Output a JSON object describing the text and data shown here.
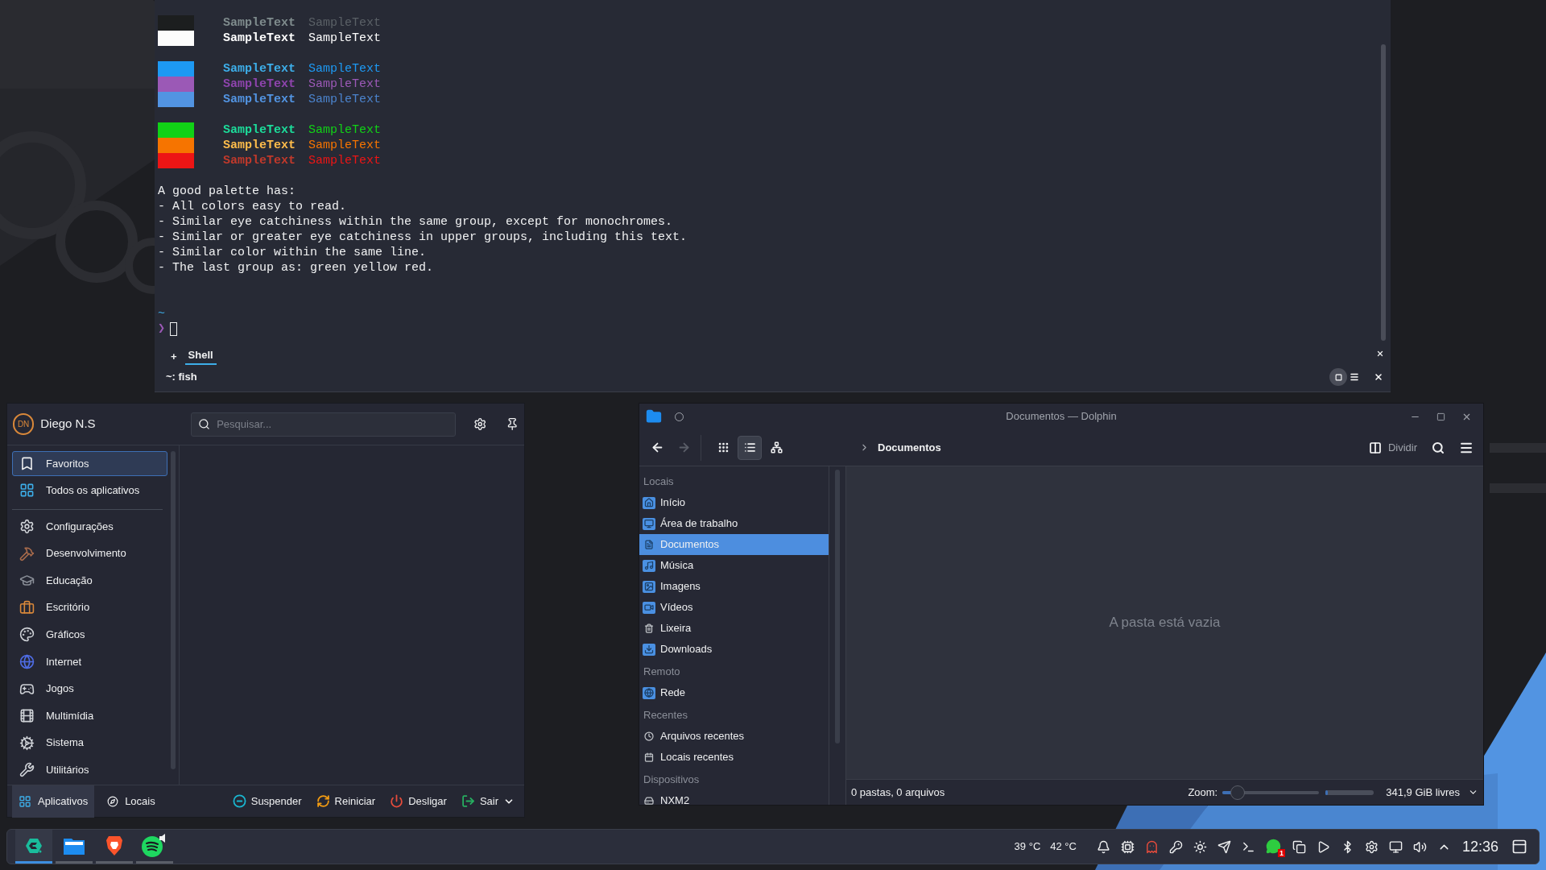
{
  "terminal": {
    "palette_groups": [
      {
        "rows": [
          {
            "color": "#1c1e1f",
            "bold": {
              "text": "SampleText",
              "color": "#7f8c8d"
            },
            "regular": {
              "text": "SampleText",
              "color": "#5a6066"
            }
          },
          {
            "color": "#fcfcfc",
            "bold": {
              "text": "SampleText",
              "color": "#ffffff"
            },
            "regular": {
              "text": "SampleText",
              "color": "#fcfcfc"
            }
          }
        ]
      },
      {
        "rows": [
          {
            "color": "#1d99f3",
            "bold": {
              "text": "SampleText",
              "color": "#3daee9"
            },
            "regular": {
              "text": "SampleText",
              "color": "#1d99f3"
            }
          },
          {
            "color": "#9b59b6",
            "bold": {
              "text": "SampleText",
              "color": "#8e44ad"
            },
            "regular": {
              "text": "SampleText",
              "color": "#9b59b6"
            }
          },
          {
            "color": "#5294e2",
            "bold": {
              "text": "SampleText",
              "color": "#5294e2"
            },
            "regular": {
              "text": "SampleText",
              "color": "#4b83cc"
            }
          }
        ]
      },
      {
        "rows": [
          {
            "color": "#11d116",
            "bold": {
              "text": "SampleText",
              "color": "#1cdc9a"
            },
            "regular": {
              "text": "SampleText",
              "color": "#11d116"
            }
          },
          {
            "color": "#f67400",
            "bold": {
              "text": "SampleText",
              "color": "#fdbc4b"
            },
            "regular": {
              "text": "SampleText",
              "color": "#f67400"
            }
          },
          {
            "color": "#ed1515",
            "bold": {
              "text": "SampleText",
              "color": "#c0392b"
            },
            "regular": {
              "text": "SampleText",
              "color": "#ed1515"
            }
          }
        ]
      }
    ],
    "notes": [
      "A good palette has:",
      "- All colors easy to read.",
      "- Similar eye catchiness within the same group, except for monochromes.",
      "- Similar or greater eye catchiness in upper groups, including this text.",
      "- Similar color within the same line.",
      "- The last group as: green yellow red."
    ],
    "prompt": {
      "path": "~",
      "symbol": "❯"
    },
    "tabs": [
      {
        "label": "Shell",
        "selected": true
      }
    ],
    "new_tab": "+",
    "status": "~: fish"
  },
  "launcher": {
    "user": {
      "initials": "DN",
      "name": "Diego N.S"
    },
    "search": {
      "placeholder": "Pesquisar..."
    },
    "views": [
      {
        "label": "Favoritos",
        "selected": true
      },
      {
        "label": "Todos os aplicativos",
        "selected": false
      }
    ],
    "categories": [
      {
        "label": "Configurações",
        "selected": false
      },
      {
        "label": "Desenvolvimento",
        "selected": false
      },
      {
        "label": "Educação",
        "selected": false
      },
      {
        "label": "Escritório",
        "selected": false
      },
      {
        "label": "Gráficos",
        "selected": false
      },
      {
        "label": "Internet",
        "selected": false
      },
      {
        "label": "Jogos",
        "selected": false
      },
      {
        "label": "Multimídia",
        "selected": false
      },
      {
        "label": "Sistema",
        "selected": false
      },
      {
        "label": "Utilitários",
        "selected": false
      }
    ],
    "footer_tabs": [
      {
        "label": "Aplicativos",
        "selected": true
      },
      {
        "label": "Locais",
        "selected": false
      }
    ],
    "actions": [
      "Suspender",
      "Reiniciar",
      "Desligar",
      "Sair"
    ]
  },
  "dolphin": {
    "window": {
      "title": "Documentos — Dolphin"
    },
    "view_modes": [
      {
        "selected": false
      },
      {
        "selected": true
      },
      {
        "selected": false
      }
    ],
    "breadcrumb": "Documentos",
    "split_button": "Dividir",
    "places": [
      {
        "heading": "Locais",
        "items": [
          {
            "label": "Início",
            "selected": false
          },
          {
            "label": "Área de trabalho",
            "selected": false
          },
          {
            "label": "Documentos",
            "selected": true
          },
          {
            "label": "Música",
            "selected": false
          },
          {
            "label": "Imagens",
            "selected": false
          },
          {
            "label": "Vídeos",
            "selected": false
          },
          {
            "label": "Lixeira",
            "selected": false
          },
          {
            "label": "Downloads",
            "selected": false
          }
        ]
      },
      {
        "heading": "Remoto",
        "items": [
          {
            "label": "Rede",
            "selected": false
          }
        ]
      },
      {
        "heading": "Recentes",
        "items": [
          {
            "label": "Arquivos recentes",
            "selected": false
          },
          {
            "label": "Locais recentes",
            "selected": false
          }
        ]
      },
      {
        "heading": "Dispositivos",
        "items": [
          {
            "label": "NXM2",
            "selected": false
          }
        ]
      }
    ],
    "empty_message": "A pasta está vazia",
    "status_bar": {
      "summary": "0 pastas, 0 arquivos",
      "zoom_label": "Zoom:",
      "zoom": {
        "level": 0.1
      },
      "disk": {
        "level": 0.05
      },
      "free_space": "341,9 GiB livres"
    }
  },
  "taskbar": {
    "apps": [
      {
        "selected": true
      },
      {
        "selected": false
      },
      {
        "selected": false
      },
      {
        "selected": false
      }
    ],
    "temperatures": [
      "39 °C",
      "42 °C"
    ],
    "chat_badge": "1",
    "clock": "12:36"
  }
}
